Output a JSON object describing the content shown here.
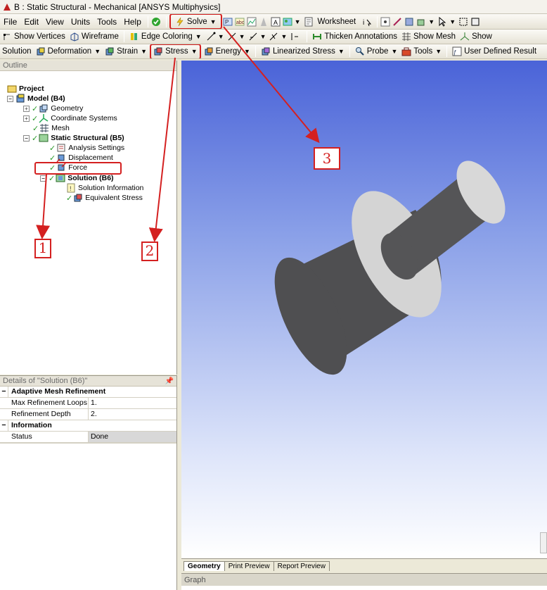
{
  "window": {
    "title": "B : Static Structural - Mechanical [ANSYS Multiphysics]"
  },
  "menu": [
    "File",
    "Edit",
    "View",
    "Units",
    "Tools",
    "Help"
  ],
  "toolbar1": {
    "solve": "Solve",
    "worksheet": "Worksheet"
  },
  "toolbar2": {
    "show_vertices": "Show Vertices",
    "wireframe": "Wireframe",
    "edge_coloring": "Edge Coloring",
    "thicken": "Thicken Annotations",
    "show_mesh": "Show Mesh",
    "show_more": "Show"
  },
  "toolbar3": {
    "solution": "Solution",
    "deformation": "Deformation",
    "strain": "Strain",
    "stress": "Stress",
    "energy": "Energy",
    "linearized": "Linearized Stress",
    "probe": "Probe",
    "tools": "Tools",
    "user_defined": "User Defined Result"
  },
  "outline": {
    "header": "Outline",
    "project": "Project",
    "model": "Model (B4)",
    "geometry": "Geometry",
    "coordinate_systems": "Coordinate Systems",
    "mesh": "Mesh",
    "static": "Static Structural (B5)",
    "analysis_settings": "Analysis Settings",
    "displacement": "Displacement",
    "force": "Force",
    "solution": "Solution (B6)",
    "solution_info": "Solution Information",
    "equivalent_stress": "Equivalent Stress"
  },
  "details": {
    "header": "Details of \"Solution (B6)\"",
    "group1": "Adaptive Mesh Refinement",
    "rows1": [
      {
        "label": "Max Refinement Loops",
        "value": "1."
      },
      {
        "label": "Refinement Depth",
        "value": "2."
      }
    ],
    "group2": "Information",
    "rows2": [
      {
        "label": "Status",
        "value": "Done"
      }
    ]
  },
  "tabs": [
    "Geometry",
    "Print Preview",
    "Report Preview"
  ],
  "graph_header": "Graph",
  "annotations": [
    "1",
    "2",
    "3"
  ],
  "colors": {
    "annotation": "#d42020",
    "part_body": "#4f4f51",
    "part_face": "#d4d4d4"
  }
}
